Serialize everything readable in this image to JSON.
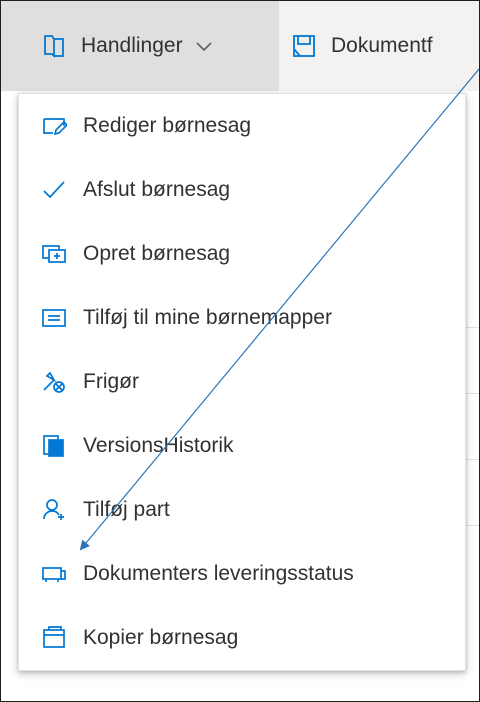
{
  "commandbar": {
    "actions_label": "Handlinger",
    "actions_icon": "book-icon",
    "document_label": "Dokumentf",
    "document_icon": "document-flow-icon"
  },
  "menu": {
    "items": [
      {
        "label": "Rediger børnesag",
        "icon": "edit-icon"
      },
      {
        "label": "Afslut børnesag",
        "icon": "checkmark-icon"
      },
      {
        "label": "Opret børnesag",
        "icon": "new-case-icon"
      },
      {
        "label": "Tilføj til mine børnemapper",
        "icon": "add-to-folder-icon"
      },
      {
        "label": "Frigør",
        "icon": "release-icon"
      },
      {
        "label": "VersionsHistorik",
        "icon": "version-history-icon"
      },
      {
        "label": "Tilføj part",
        "icon": "add-person-icon"
      },
      {
        "label": "Dokumenters leveringsstatus",
        "icon": "delivery-status-icon"
      },
      {
        "label": "Kopier børnesag",
        "icon": "copy-case-icon"
      }
    ]
  },
  "colors": {
    "accent": "#0078d4",
    "annotation_arrow": "#2e75b6",
    "commandbar_bg": "#f3f2f1",
    "active_command_bg": "#e1dfdd",
    "text": "#323130"
  }
}
